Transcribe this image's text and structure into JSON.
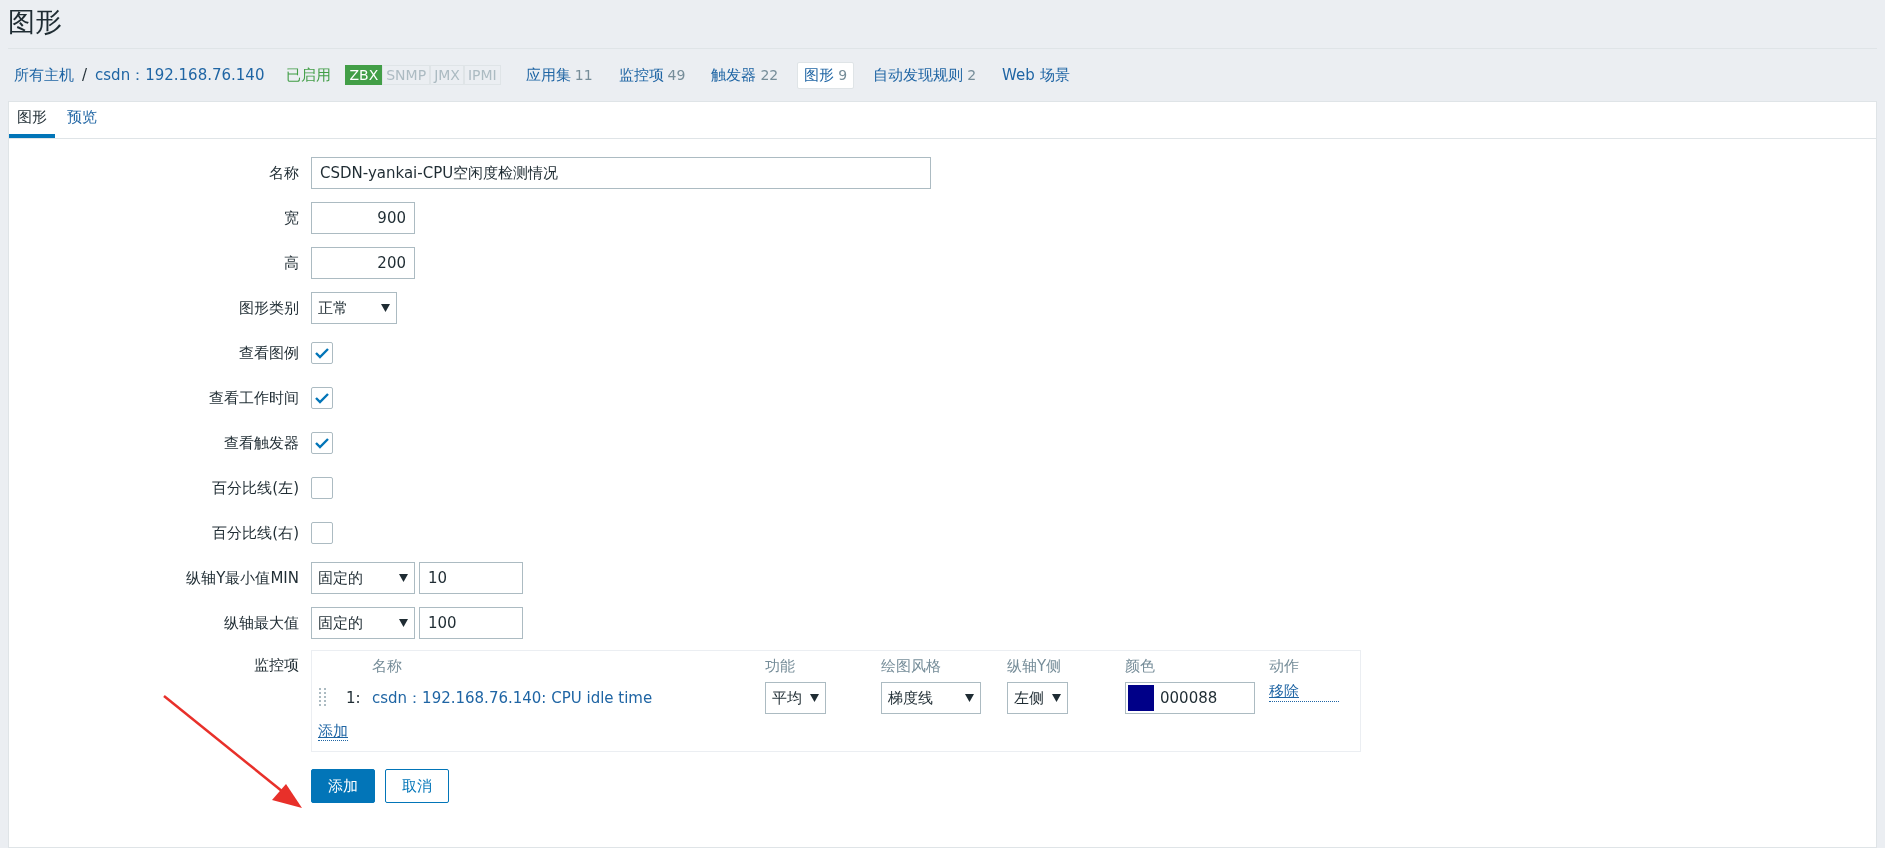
{
  "page_title": "图形",
  "breadcrumb": [
    {
      "label": "所有主机"
    },
    {
      "label": "csdn：192.168.76.140"
    }
  ],
  "breadcrumb_separator": "/",
  "status": "已启用",
  "interfaces": [
    {
      "label": "ZBX",
      "on": true
    },
    {
      "label": "SNMP",
      "on": false
    },
    {
      "label": "JMX",
      "on": false
    },
    {
      "label": "IPMI",
      "on": false
    }
  ],
  "nav": [
    {
      "label": "应用集",
      "count": "11",
      "selected": false
    },
    {
      "label": "监控项",
      "count": "49",
      "selected": false
    },
    {
      "label": "触发器",
      "count": "22",
      "selected": false
    },
    {
      "label": "图形",
      "count": "9",
      "selected": true
    },
    {
      "label": "自动发现规则",
      "count": "2",
      "selected": false
    },
    {
      "label": "Web 场景",
      "selected": false
    }
  ],
  "tabs": [
    {
      "label": "图形",
      "selected": true
    },
    {
      "label": "预览",
      "selected": false
    }
  ],
  "form": [
    {
      "kind": "text",
      "label": "名称",
      "value": "CSDN-yankai-CPU空闲度检测情况"
    },
    {
      "kind": "number",
      "label": "宽",
      "value": "900"
    },
    {
      "kind": "number",
      "label": "高",
      "value": "200"
    },
    {
      "kind": "select",
      "label": "图形类别",
      "value": "正常"
    },
    {
      "kind": "checkbox",
      "label": "查看图例",
      "checked": true
    },
    {
      "kind": "checkbox",
      "label": "查看工作时间",
      "checked": true
    },
    {
      "kind": "checkbox",
      "label": "查看触发器",
      "checked": true
    },
    {
      "kind": "checkbox",
      "label": "百分比线(左)",
      "checked": false
    },
    {
      "kind": "checkbox",
      "label": "百分比线(右)",
      "checked": false
    },
    {
      "kind": "axis",
      "label": "纵轴Y最小值MIN",
      "mode": "固定的",
      "value": "10"
    },
    {
      "kind": "axis",
      "label": "纵轴最大值",
      "mode": "固定的",
      "value": "100"
    }
  ],
  "items": {
    "label": "监控项",
    "columns": [
      "名称",
      "功能",
      "绘图风格",
      "纵轴Y侧",
      "颜色",
      "动作"
    ],
    "rows": [
      {
        "index": "1:",
        "name": "csdn：192.168.76.140: CPU idle time",
        "function": "平均",
        "style": "梯度线",
        "axis": "左侧",
        "color": "#000088",
        "color_text": "000088",
        "action": "移除"
      }
    ],
    "add_link": "添加"
  },
  "buttons": [
    {
      "label": "添加",
      "primary": true
    },
    {
      "label": "取消",
      "primary": false
    }
  ]
}
